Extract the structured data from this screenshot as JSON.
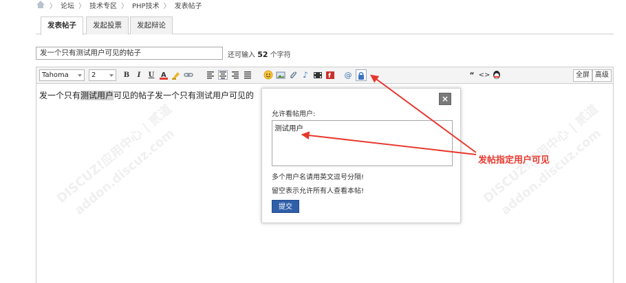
{
  "breadcrumb": [
    "论坛",
    "技术专区",
    "PHP技术",
    "发表帖子"
  ],
  "tabs": [
    {
      "label": "发表帖子",
      "active": true
    },
    {
      "label": "发起投票",
      "active": false
    },
    {
      "label": "发起辩论",
      "active": false
    }
  ],
  "subject": {
    "value": "发一个只有测试用户可见的帖子",
    "remain_prefix": "还可输入",
    "remain_count": "52",
    "remain_suffix": "个字符"
  },
  "toolbar": {
    "font": "Tahoma",
    "size": "2",
    "icons": [
      "bold-icon",
      "italic-icon",
      "underline-icon",
      "font-color-icon",
      "highlight-icon",
      "link-icon",
      "align-left-icon",
      "align-center-icon",
      "align-right-icon",
      "align-justify-icon",
      "emoticon-icon",
      "image-icon",
      "attachment-icon",
      "audio-icon",
      "video-icon",
      "flash-icon",
      "at-icon",
      "hide-icon",
      "quote-icon",
      "code-icon",
      "qq-icon"
    ],
    "fullscreen": "全屏",
    "advanced": "高级"
  },
  "editor": {
    "content_before": "发一个只有",
    "content_highlight": "测试用户",
    "content_after": "可见的帖子发一个只有测试用户可见的"
  },
  "popup": {
    "label": "允许看帖用户:",
    "textarea_value": "测试用户",
    "hint1": "多个用户名请用英文逗号分隔!",
    "hint2": "留空表示允许所有人查看本帖!",
    "submit": "提交"
  },
  "annotation": "发帖指定用户可见",
  "watermark": {
    "line1": "DISCUZ!应用中心 | 贰道",
    "line2": "addon.discuz.com"
  },
  "colors": {
    "accent": "#2f5fa8",
    "annotation": "#e8382d"
  }
}
